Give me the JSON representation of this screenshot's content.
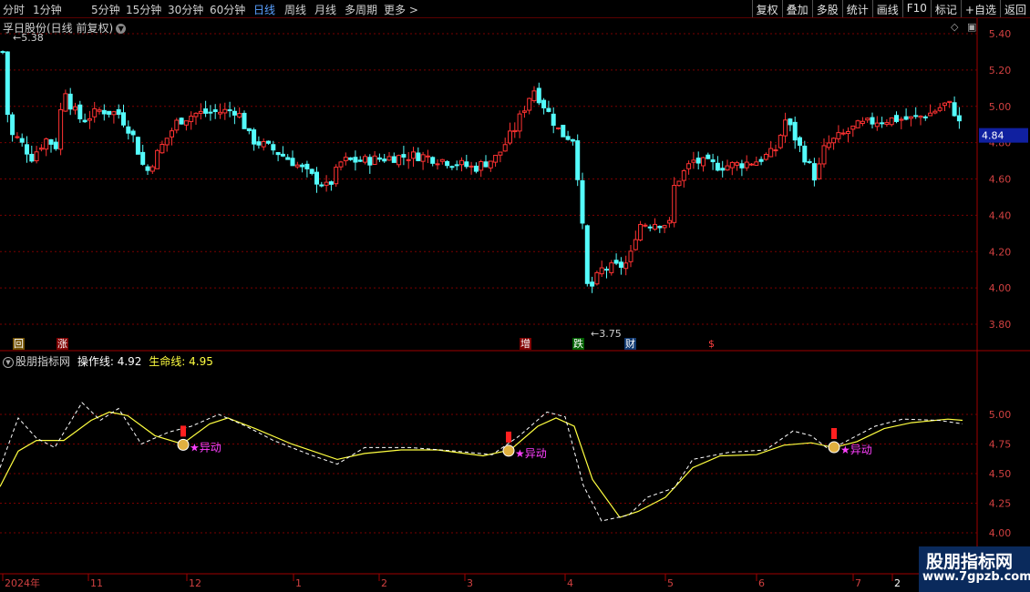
{
  "toolbar": {
    "periods": [
      "分时",
      "1分钟",
      "5分钟",
      "15分钟",
      "30分钟",
      "60分钟",
      "日线",
      "周线",
      "月线",
      "多周期",
      "更多 >"
    ],
    "active_period": "日线",
    "tools": [
      "复权",
      "叠加",
      "多股",
      "统计",
      "画线",
      "F10",
      "标记",
      "+自选",
      "返回"
    ]
  },
  "stock": {
    "title": "孚日股份(日线 前复权)"
  },
  "main_chart": {
    "price_axis": [
      "5.40",
      "5.20",
      "5.00",
      "4.80",
      "4.60",
      "4.40",
      "4.20",
      "4.00",
      "3.80"
    ],
    "current_price_tag": "4.84",
    "high_label": "5.38",
    "low_label": "3.75",
    "markers": [
      {
        "label": "回",
        "color": "#c08000"
      },
      {
        "label": "涨",
        "color": "#c00000"
      },
      {
        "label": "增",
        "color": "#c00000"
      },
      {
        "label": "跌",
        "color": "#008000"
      },
      {
        "label": "财",
        "color": "#1060c0"
      },
      {
        "label": "$",
        "color": "#ff4040"
      }
    ],
    "colors": {
      "up": "#ff3232",
      "down": "#54fcfc",
      "grid": "#7a0000"
    }
  },
  "indicator": {
    "name": "股朋指标网",
    "line1_label": "操作线:",
    "line1_value": "4.92",
    "line2_label": "生命线:",
    "line2_value": "4.95",
    "axis": [
      "5.00",
      "4.75",
      "4.50",
      "4.25",
      "4.00"
    ],
    "signal_label": "★异动"
  },
  "time_axis": [
    "2024年",
    "11",
    "12",
    "1",
    "2",
    "3",
    "4",
    "5",
    "6",
    "7",
    "2"
  ],
  "watermark": {
    "title": "股朋指标网",
    "url": "www.7gpzb.com"
  }
}
